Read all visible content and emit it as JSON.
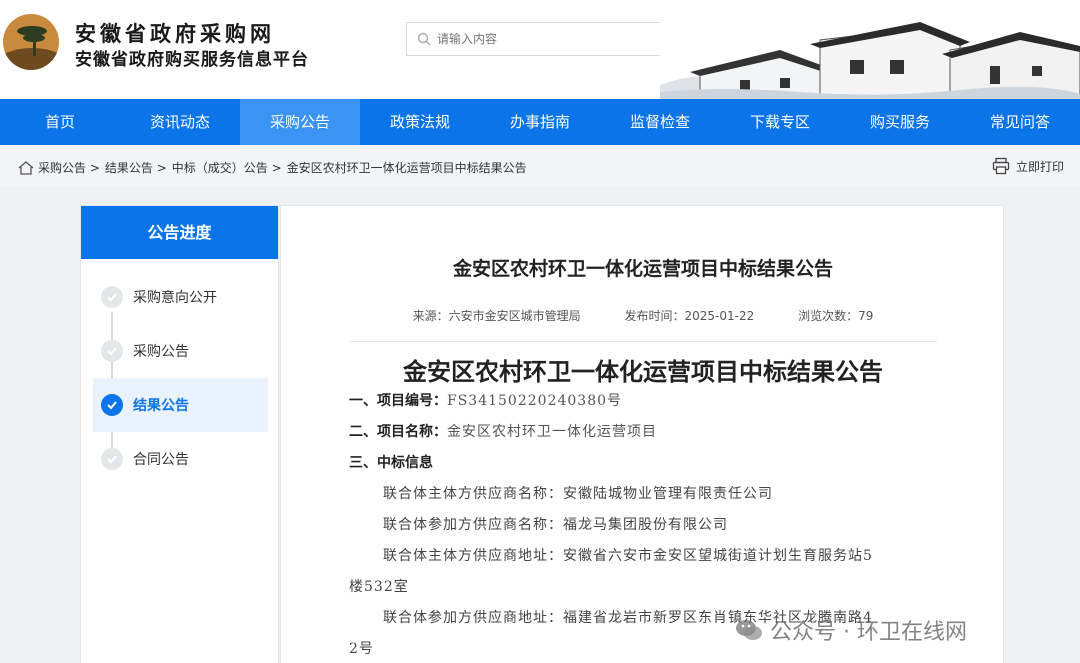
{
  "header": {
    "title": "安徽省政府采购网",
    "subtitle": "安徽省政府购买服务信息平台",
    "search_placeholder": "请输入内容",
    "search_button": "搜索"
  },
  "nav": {
    "items": [
      "首页",
      "资讯动态",
      "采购公告",
      "政策法规",
      "办事指南",
      "监督检查",
      "下载专区",
      "购买服务",
      "常见问答"
    ],
    "active_index": 2
  },
  "breadcrumb": {
    "items": [
      "采购公告 >",
      "结果公告 >",
      "中标（成交）公告 >",
      "金安区农村环卫一体化运营项目中标结果公告"
    ],
    "print_label": "立即打印"
  },
  "sidebar": {
    "title": "公告进度",
    "steps": [
      "采购意向公开",
      "采购公告",
      "结果公告",
      "合同公告"
    ],
    "active_index": 2
  },
  "article": {
    "title": "金安区农村环卫一体化运营项目中标结果公告",
    "source": "来源：六安市金安区城市管理局",
    "publish_time": "发布时间：2025-01-22",
    "views": "浏览次数：79",
    "heading": "金安区农村环卫一体化运营项目中标结果公告",
    "project_no_key": "一、项目编号：",
    "project_no_val": "FS34150220240380号",
    "project_name_key": "二、项目名称：",
    "project_name_val": "金安区农村环卫一体化运营项目",
    "winner_key": "三、中标信息",
    "lead_supplier": "联合体主体方供应商名称：安徽陆城物业管理有限责任公司",
    "member_supplier": "联合体参加方供应商名称：福龙马集团股份有限公司",
    "lead_address_1": "联合体主体方供应商地址：安徽省六安市金安区望城街道计划生育服务站5",
    "lead_address_2": "楼532室",
    "member_address_1": "联合体参加方供应商地址：福建省龙岩市新罗区东肖镇东华社区龙腾南路4",
    "member_address_2": "2号"
  },
  "watermark": {
    "text": "公众号 · 环卫在线网"
  },
  "colors": {
    "primary": "#0a74e8",
    "nav_active": "#3b94f3"
  }
}
